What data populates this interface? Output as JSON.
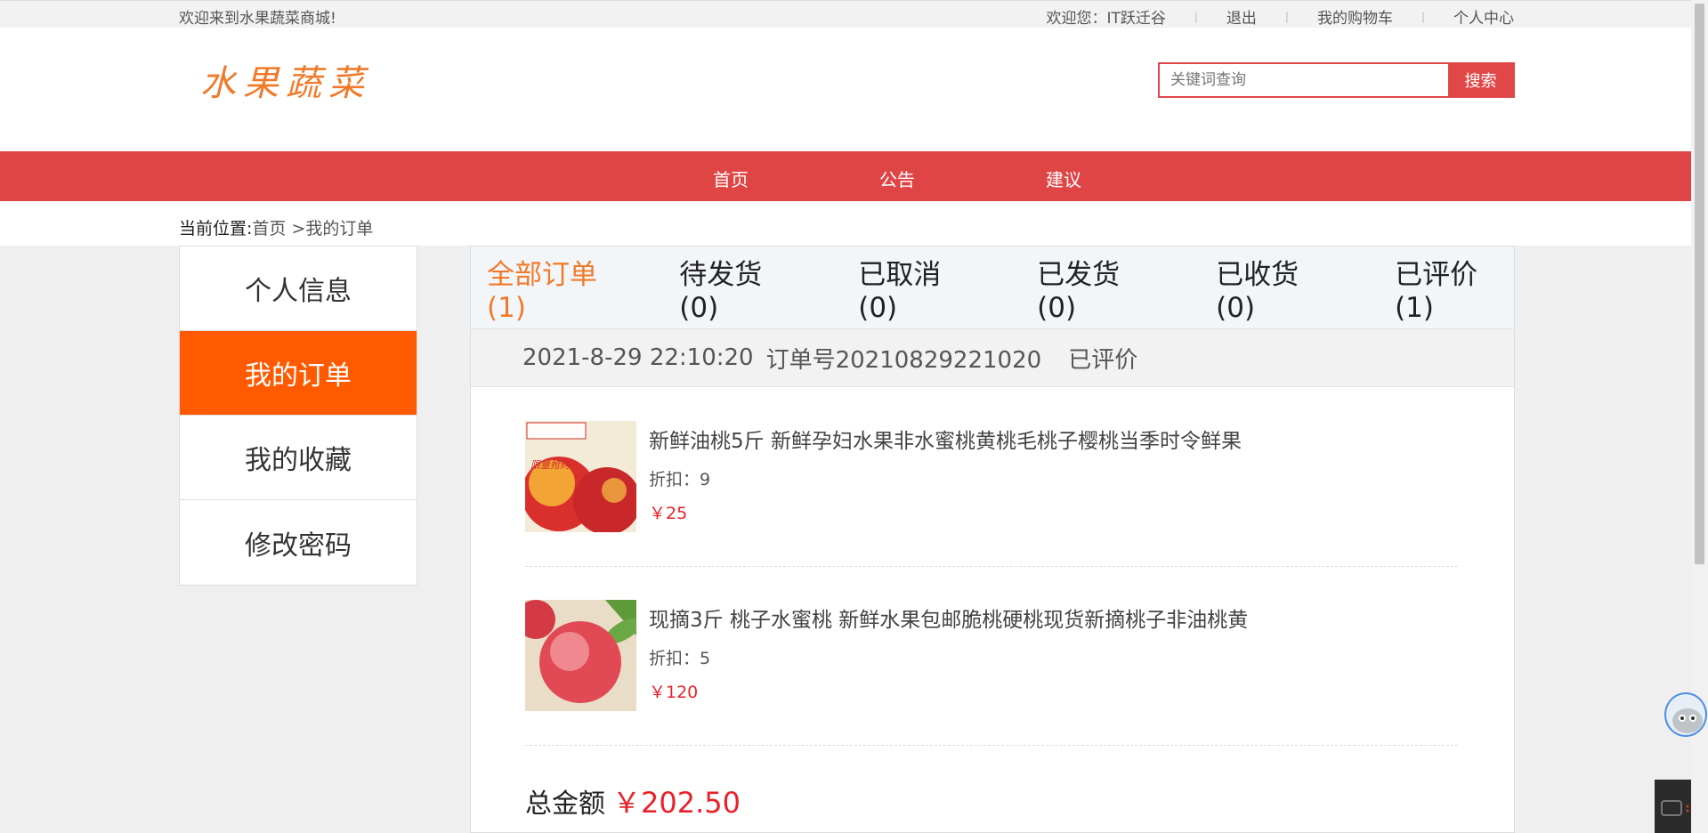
{
  "topbar": {
    "welcome": "欢迎来到水果蔬菜商城!",
    "user_greeting": "欢迎您：IT跃迁谷",
    "logout": "退出",
    "cart": "我的购物车",
    "profile": "个人中心"
  },
  "header": {
    "logo_text": "水果蔬菜",
    "search_placeholder": "关键词查询",
    "search_button": "搜索"
  },
  "nav": {
    "items": [
      {
        "label": "首页"
      },
      {
        "label": "公告"
      },
      {
        "label": "建议"
      }
    ]
  },
  "breadcrumb": {
    "prefix": "当前位置:",
    "home": "首页",
    "current": " >我的订单"
  },
  "sidebar": {
    "items": [
      {
        "label": "个人信息"
      },
      {
        "label": "我的订单"
      },
      {
        "label": "我的收藏"
      },
      {
        "label": "修改密码"
      }
    ]
  },
  "tabs": [
    {
      "label": "全部订单(1)"
    },
    {
      "label": "待发货(0)"
    },
    {
      "label": "已取消(0)"
    },
    {
      "label": "已发货(0)"
    },
    {
      "label": "已收货(0)"
    },
    {
      "label": "已评价(1)"
    }
  ],
  "order": {
    "datetime": "2021-8-29 22:10:20",
    "order_no": "订单号20210829221020",
    "status": "已评价",
    "products": [
      {
        "title": "新鲜油桃5斤 新鲜孕妇水果非水蜜桃黄桃毛桃子樱桃当季时令鲜果",
        "discount": "折扣：9",
        "price": "￥25",
        "badge": "限量抢购"
      },
      {
        "title": "现摘3斤 桃子水蜜桃 新鲜水果包邮脆桃硬桃现货新摘桃子非油桃黄",
        "discount": "折扣：5",
        "price": "￥120"
      }
    ],
    "total_label": "总金额",
    "total_amount": "￥202.50"
  },
  "colors": {
    "brand_red": "#e04545",
    "accent_orange": "#ff5a00",
    "price_red": "#e8222b"
  }
}
